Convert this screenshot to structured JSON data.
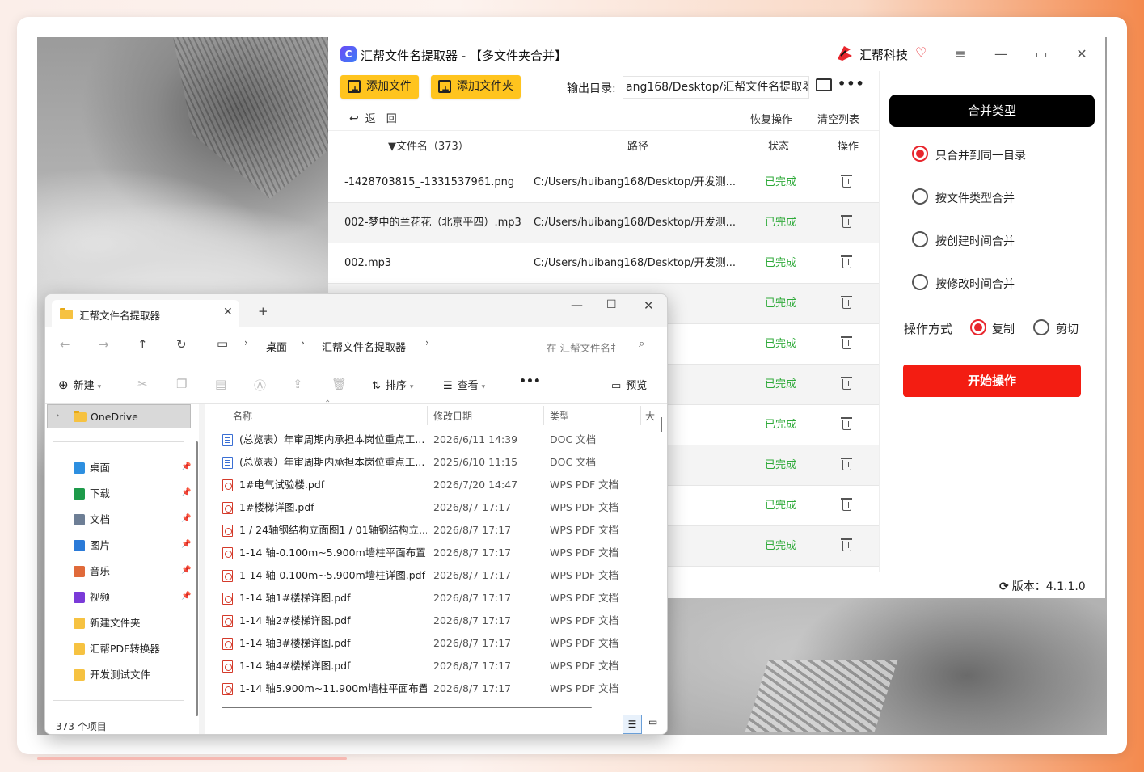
{
  "app": {
    "title": "汇帮文件名提取器 - 【多文件夹合并】",
    "logo_letter": "C",
    "brand": "汇帮科技",
    "window_controls": [
      "≡",
      "—",
      "▭",
      "✕"
    ]
  },
  "toolbar": {
    "add_file": "添加文件",
    "add_folder": "添加文件夹",
    "output_label": "输出目录:",
    "output_path": "ang168/Desktop/汇帮文件名提取器",
    "more": "•••",
    "back": "返　回",
    "restore": "恢复操作",
    "clear": "清空列表"
  },
  "table": {
    "headers": {
      "name": "▼文件名（373）",
      "path": "路径",
      "status": "状态",
      "op": "操作"
    },
    "rows": [
      {
        "name": "-1428703815_-1331537961.png",
        "path": "C:/Users/huibang168/Desktop/开发测...",
        "status": "已完成"
      },
      {
        "name": "002-梦中的兰花花（北京平四）.mp3",
        "path": "C:/Users/huibang168/Desktop/开发测...",
        "status": "已完成"
      },
      {
        "name": "002.mp3",
        "path": "C:/Users/huibang168/Desktop/开发测...",
        "status": "已完成"
      },
      {
        "name": "",
        "path": "p/开发测...",
        "status": "已完成"
      },
      {
        "name": "",
        "path": "p/开发测...",
        "status": "已完成"
      },
      {
        "name": "",
        "path": "p/开发测...",
        "status": "已完成"
      },
      {
        "name": "",
        "path": "p/开发测...",
        "status": "已完成"
      },
      {
        "name": "",
        "path": "p/开发测...",
        "status": "已完成"
      },
      {
        "name": "",
        "path": "p/开发测...",
        "status": "已完成"
      },
      {
        "name": "",
        "path": "p/开发测...",
        "status": "已完成"
      }
    ]
  },
  "side": {
    "merge_title": "合并类型",
    "options": [
      {
        "label": "只合并到同一目录",
        "selected": true
      },
      {
        "label": "按文件类型合并",
        "selected": false
      },
      {
        "label": "按创建时间合并",
        "selected": false
      },
      {
        "label": "按修改时间合并",
        "selected": false
      }
    ],
    "op_label": "操作方式",
    "copy": "复制",
    "cut": "剪切",
    "start": "开始操作",
    "version": "版本：4.1.1.0"
  },
  "explorer": {
    "tab_title": "汇帮文件名提取器",
    "new_tab": "+",
    "breadcrumb": [
      "桌面",
      "汇帮文件名提取器"
    ],
    "search_placeholder": "在 汇帮文件名扌",
    "cmd": {
      "new": "新建",
      "sort": "排序",
      "view": "查看",
      "more": "•••",
      "preview": "预览"
    },
    "onedrive": "OneDrive",
    "nav": [
      {
        "label": "桌面",
        "pinned": true,
        "color": "#2d8fe0"
      },
      {
        "label": "下载",
        "pinned": true,
        "color": "#1d9a4a"
      },
      {
        "label": "文档",
        "pinned": true,
        "color": "#6d7e95"
      },
      {
        "label": "图片",
        "pinned": true,
        "color": "#2a7ad8"
      },
      {
        "label": "音乐",
        "pinned": true,
        "color": "#e06a3a"
      },
      {
        "label": "视频",
        "pinned": true,
        "color": "#7a3ad8"
      },
      {
        "label": "新建文件夹",
        "pinned": false,
        "color": "#f6c241"
      },
      {
        "label": "汇帮PDF转换器",
        "pinned": false,
        "color": "#f6c241"
      },
      {
        "label": "开发测试文件",
        "pinned": false,
        "color": "#f6c241"
      }
    ],
    "columns": {
      "name": "名称",
      "date": "修改日期",
      "type": "类型",
      "size": "大"
    },
    "files": [
      {
        "name": "(总览表）年审周期内承担本岗位重点工...",
        "date": "2026/6/11 14:39",
        "type": "DOC 文档",
        "kind": "doc"
      },
      {
        "name": "(总览表）年审周期内承担本岗位重点工...",
        "date": "2025/6/10 11:15",
        "type": "DOC 文档",
        "kind": "doc"
      },
      {
        "name": "1#电气试验楼.pdf",
        "date": "2026/7/20 14:47",
        "type": "WPS PDF 文档",
        "kind": "pdf"
      },
      {
        "name": "1#楼梯详图.pdf",
        "date": "2026/8/7 17:17",
        "type": "WPS PDF 文档",
        "kind": "pdf"
      },
      {
        "name": "1 / 24轴钢结构立面图1 / 01轴钢结构立...",
        "date": "2026/8/7 17:17",
        "type": "WPS PDF 文档",
        "kind": "pdf"
      },
      {
        "name": "1-14 轴-0.100m~5.900m墙柱平面布置...",
        "date": "2026/8/7 17:17",
        "type": "WPS PDF 文档",
        "kind": "pdf"
      },
      {
        "name": "1-14 轴-0.100m~5.900m墙柱详图.pdf",
        "date": "2026/8/7 17:17",
        "type": "WPS PDF 文档",
        "kind": "pdf"
      },
      {
        "name": "1-14 轴1#楼梯详图.pdf",
        "date": "2026/8/7 17:17",
        "type": "WPS PDF 文档",
        "kind": "pdf"
      },
      {
        "name": "1-14 轴2#楼梯详图.pdf",
        "date": "2026/8/7 17:17",
        "type": "WPS PDF 文档",
        "kind": "pdf"
      },
      {
        "name": "1-14 轴3#楼梯详图.pdf",
        "date": "2026/8/7 17:17",
        "type": "WPS PDF 文档",
        "kind": "pdf"
      },
      {
        "name": "1-14 轴4#楼梯详图.pdf",
        "date": "2026/8/7 17:17",
        "type": "WPS PDF 文档",
        "kind": "pdf"
      },
      {
        "name": "1-14 轴5.900m~11.900m墙柱平面布置...",
        "date": "2026/8/7 17:17",
        "type": "WPS PDF 文档",
        "kind": "pdf"
      }
    ],
    "status": "373 个项目"
  }
}
